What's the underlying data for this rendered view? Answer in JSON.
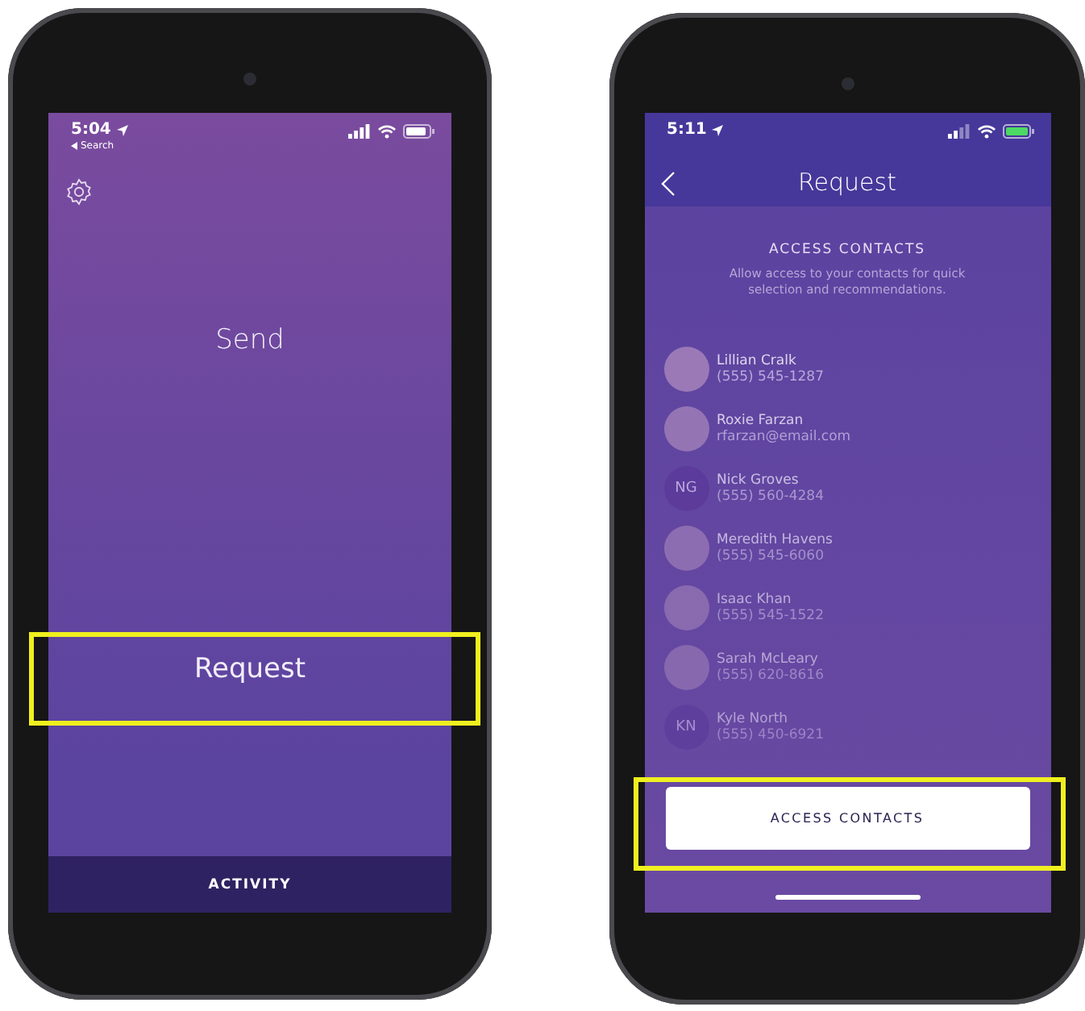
{
  "phones": [
    {
      "status_bar": {
        "time": "5:04",
        "back_link": "Search"
      },
      "send_label": "Send",
      "request_label": "Request",
      "tab_bar": {
        "label": "ACTIVITY"
      }
    },
    {
      "status_bar": {
        "time": "5:11"
      },
      "nav": {
        "title": "Request"
      },
      "heading": "ACCESS CONTACTS",
      "description": "Allow access to your contacts for quick selection and recommendations.",
      "contacts": [
        {
          "name": "Lillian Cralk",
          "detail": "(555) 545-1287",
          "kind": "photo"
        },
        {
          "name": "Roxie Farzan",
          "detail": "rfarzan@email.com",
          "kind": "photo"
        },
        {
          "name": "Nick Groves",
          "detail": "(555) 560-4284",
          "kind": "initials",
          "initials": "NG"
        },
        {
          "name": "Meredith Havens",
          "detail": "(555) 545-6060",
          "kind": "photo"
        },
        {
          "name": "Isaac Khan",
          "detail": "(555) 545-1522",
          "kind": "photo"
        },
        {
          "name": "Sarah McLeary",
          "detail": "(555) 620-8616",
          "kind": "photo"
        },
        {
          "name": "Kyle North",
          "detail": "(555) 450-6921",
          "kind": "initials",
          "initials": "KN"
        }
      ],
      "button": "ACCESS CONTACTS"
    }
  ]
}
